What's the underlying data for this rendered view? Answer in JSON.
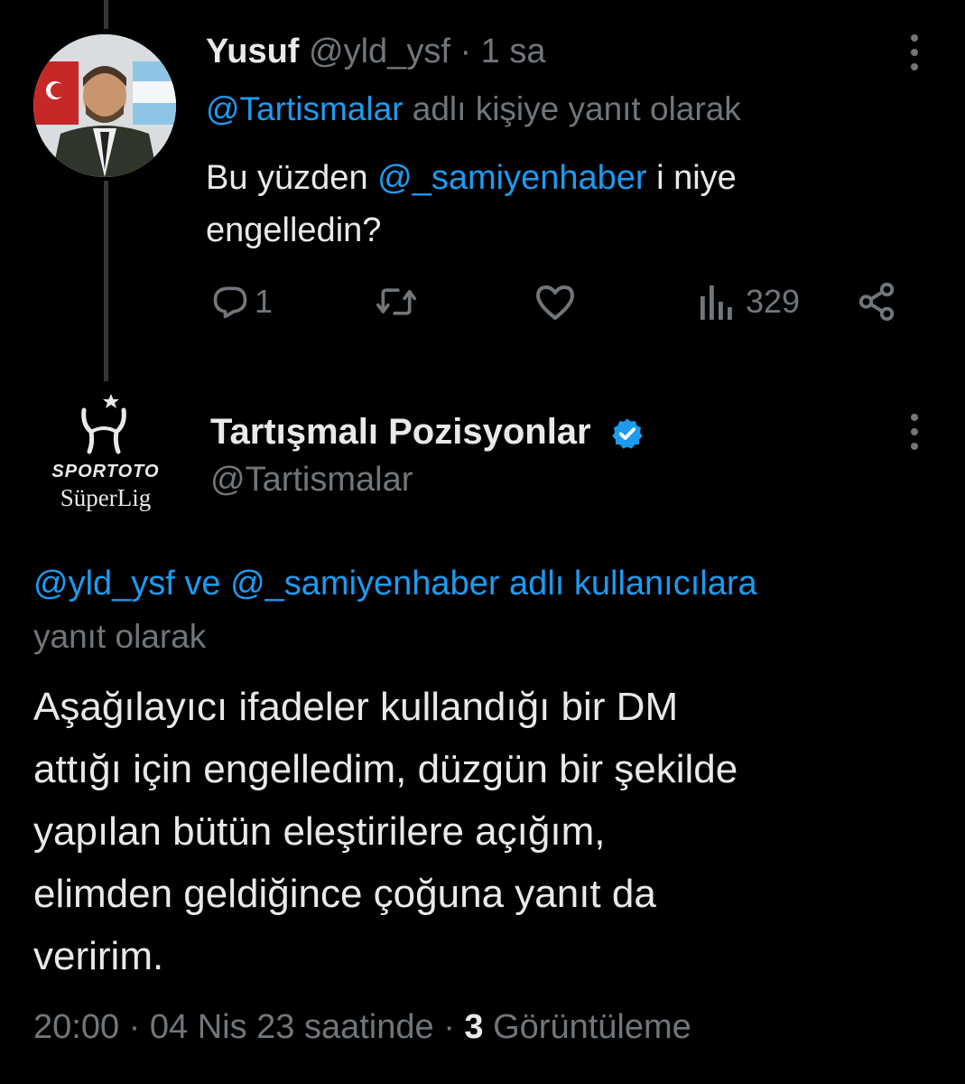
{
  "reply_tweet": {
    "display_name": "Yusuf",
    "handle": "@yld_ysf",
    "separator": "·",
    "time": "1 sa",
    "reply_to_handle": "@Tartismalar",
    "reply_to_suffix": "adlı kişiye yanıt olarak",
    "text_prefix": "Bu yüzden",
    "text_mention": "@_samiyenhaber",
    "text_line1_suffix": "i niye",
    "text_line2": "engelledin?",
    "reply_count": "1",
    "view_count": "329",
    "icons": [
      "reply-icon",
      "retweet-icon",
      "like-icon",
      "views-icon",
      "share-icon",
      "more-icon"
    ]
  },
  "main_tweet": {
    "display_name": "Tartışmalı Pozisyonlar",
    "handle": "@Tartismalar",
    "verified": true,
    "avatar_logo_top": "SPORTOTO",
    "avatar_logo_bottom": "SüperLig",
    "reply_mentions": "@yld_ysf ve @_samiyenhaber adlı kullanıcılara",
    "reply_suffix": "yanıt olarak",
    "text_lines": [
      "Aşağılayıcı ifadeler kullandığı bir DM",
      "attığı için engelledim, düzgün bir şekilde",
      "yapılan bütün eleştirilere açığım,",
      "elimden geldiğince çoğuna yanıt da",
      "veririm."
    ],
    "timestamp": "20:00 · 04 Nis 23 saatinde",
    "separator": "·",
    "view_count": "3",
    "view_label": "Görüntüleme"
  },
  "colors": {
    "background": "#000000",
    "text": "#e7e9ea",
    "muted": "#71767b",
    "link": "#1d9bf0",
    "thread_line": "#333639"
  }
}
